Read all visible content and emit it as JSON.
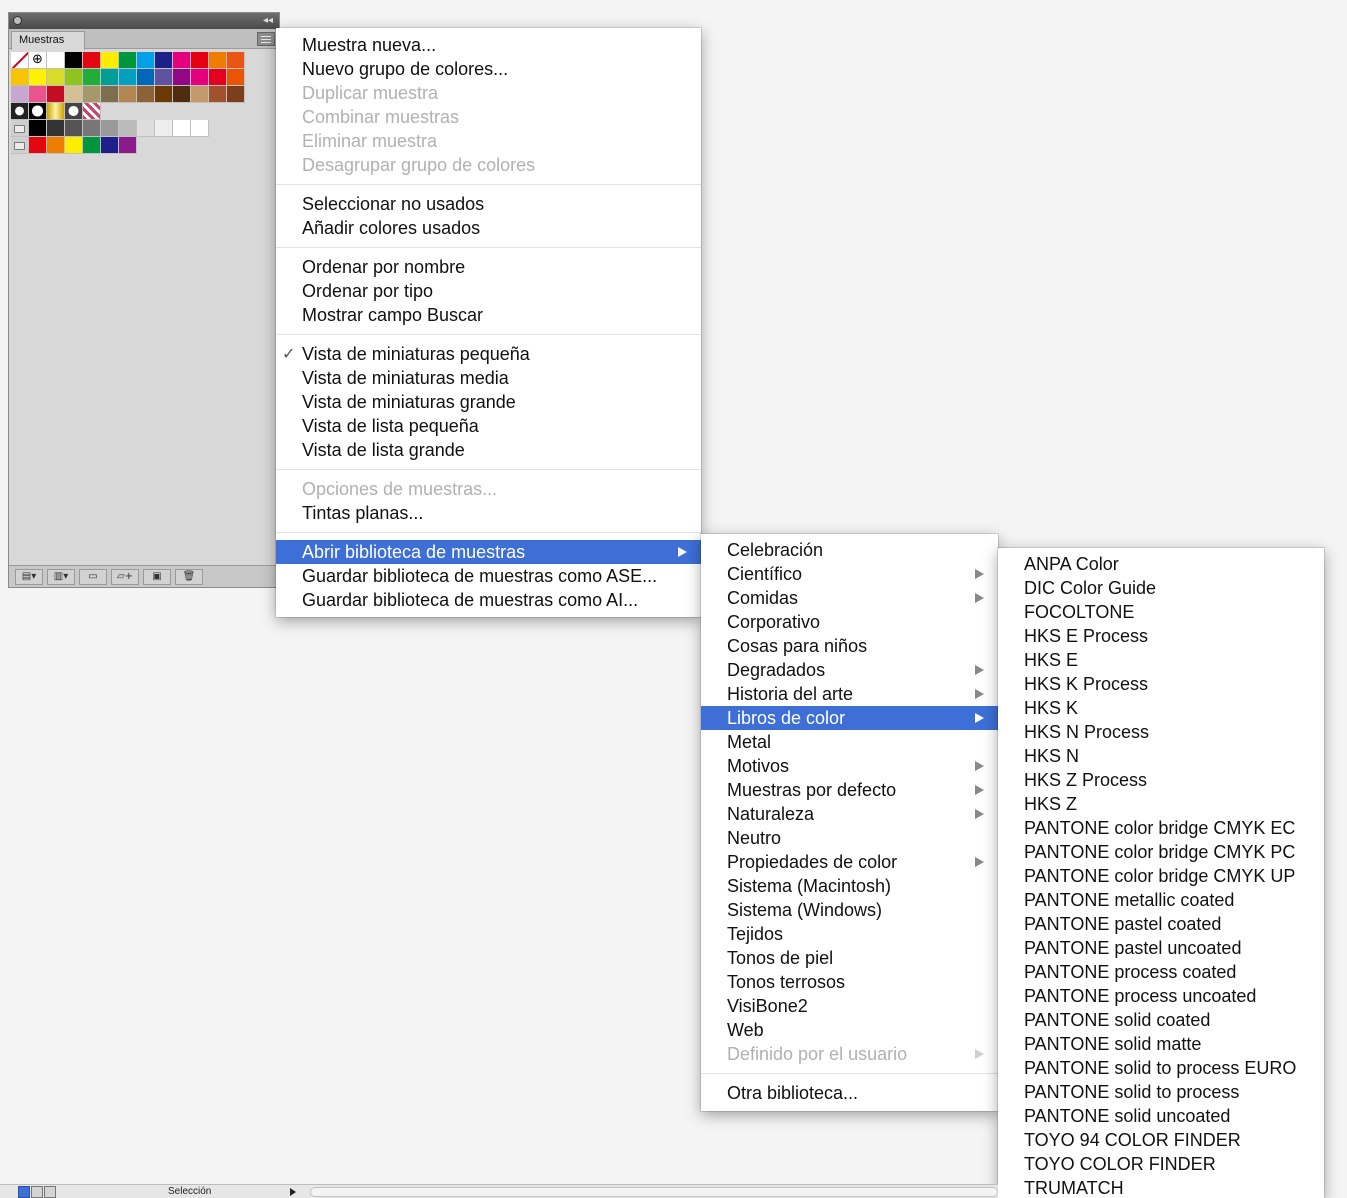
{
  "panel": {
    "tab_label": "Muestras",
    "swatch_rows": [
      [
        "none",
        "registration",
        "#ffffff",
        "#000000",
        "#e30613",
        "#ffed00",
        "#009640",
        "#00a0e9",
        "#1d2088",
        "#e4007f",
        "#e50012",
        "#ef7d00",
        "#e95513"
      ],
      [
        "#f8c300",
        "#fff100",
        "#d7dd27",
        "#8fc31f",
        "#22ac38",
        "#009e96",
        "#00a0c1",
        "#0068b7",
        "#5f52a0",
        "#920783",
        "#e5007f",
        "#e6001f",
        "#ea5504"
      ],
      [
        "#c7a7d0",
        "#e9548c",
        "#c30d23",
        "#d3c195",
        "#a5986d",
        "#7d6f4e",
        "#b28650",
        "#8d6238",
        "#6a3906",
        "#4e2c0f",
        "#c49a6c",
        "#a0522d",
        "#7b3f1d"
      ],
      [
        "pattern",
        "pattern",
        "pattern",
        "pattern",
        "pattern"
      ],
      [
        "folder",
        "#000000",
        "#333333",
        "#555555",
        "#777777",
        "#999999",
        "#bbbbbb",
        "#dddddd",
        "#eeeeee",
        "#ffffff",
        "#ffffff"
      ],
      [
        "folder",
        "#e30613",
        "#ef7d00",
        "#ffed00",
        "#009640",
        "#1d2088",
        "#8b1a8b"
      ]
    ]
  },
  "main_menu": {
    "groups": [
      [
        {
          "label": "Muestra nueva...",
          "disabled": false
        },
        {
          "label": "Nuevo grupo de colores...",
          "disabled": false
        },
        {
          "label": "Duplicar muestra",
          "disabled": true
        },
        {
          "label": "Combinar muestras",
          "disabled": true
        },
        {
          "label": "Eliminar muestra",
          "disabled": true
        },
        {
          "label": "Desagrupar grupo de colores",
          "disabled": true
        }
      ],
      [
        {
          "label": "Seleccionar no usados",
          "disabled": false
        },
        {
          "label": "Añadir colores usados",
          "disabled": false
        }
      ],
      [
        {
          "label": "Ordenar por nombre",
          "disabled": false
        },
        {
          "label": "Ordenar por tipo",
          "disabled": false
        },
        {
          "label": "Mostrar campo Buscar",
          "disabled": false
        }
      ],
      [
        {
          "label": "Vista de miniaturas pequeña",
          "disabled": false,
          "checked": true
        },
        {
          "label": "Vista de miniaturas media",
          "disabled": false
        },
        {
          "label": "Vista de miniaturas grande",
          "disabled": false
        },
        {
          "label": "Vista de lista pequeña",
          "disabled": false
        },
        {
          "label": "Vista de lista grande",
          "disabled": false
        }
      ],
      [
        {
          "label": "Opciones de muestras...",
          "disabled": true
        },
        {
          "label": "Tintas planas...",
          "disabled": false
        }
      ],
      [
        {
          "label": "Abrir biblioteca de muestras",
          "disabled": false,
          "highlight": true,
          "submenu": true
        },
        {
          "label": "Guardar biblioteca de muestras como ASE...",
          "disabled": false
        },
        {
          "label": "Guardar biblioteca de muestras como AI...",
          "disabled": false
        }
      ]
    ]
  },
  "sub_menu": {
    "groups": [
      [
        {
          "label": "Celebración"
        },
        {
          "label": "Científico",
          "submenu": true
        },
        {
          "label": "Comidas",
          "submenu": true
        },
        {
          "label": "Corporativo"
        },
        {
          "label": "Cosas para niños"
        },
        {
          "label": "Degradados",
          "submenu": true
        },
        {
          "label": "Historia del arte",
          "submenu": true
        },
        {
          "label": "Libros de color",
          "submenu": true,
          "highlight": true
        },
        {
          "label": "Metal"
        },
        {
          "label": "Motivos",
          "submenu": true
        },
        {
          "label": "Muestras por defecto",
          "submenu": true
        },
        {
          "label": "Naturaleza",
          "submenu": true
        },
        {
          "label": "Neutro"
        },
        {
          "label": "Propiedades de color",
          "submenu": true
        },
        {
          "label": "Sistema (Macintosh)"
        },
        {
          "label": "Sistema (Windows)"
        },
        {
          "label": "Tejidos"
        },
        {
          "label": "Tonos de piel"
        },
        {
          "label": "Tonos terrosos"
        },
        {
          "label": "VisiBone2"
        },
        {
          "label": "Web"
        },
        {
          "label": "Definido por el usuario",
          "submenu": true,
          "disabled": true
        }
      ],
      [
        {
          "label": "Otra biblioteca..."
        }
      ]
    ]
  },
  "sub_sub_menu": {
    "items": [
      "ANPA Color",
      "DIC Color Guide",
      "FOCOLTONE",
      "HKS E Process",
      "HKS E",
      "HKS K Process",
      "HKS K",
      "HKS N Process",
      "HKS N",
      "HKS Z Process",
      "HKS Z",
      "PANTONE color bridge CMYK EC",
      "PANTONE color bridge CMYK PC",
      "PANTONE color bridge CMYK UP",
      "PANTONE metallic coated",
      "PANTONE pastel coated",
      "PANTONE pastel uncoated",
      "PANTONE process coated",
      "PANTONE process uncoated",
      "PANTONE solid coated",
      "PANTONE solid matte",
      "PANTONE solid to process EURO",
      "PANTONE solid to process",
      "PANTONE solid uncoated",
      "TOYO 94 COLOR FINDER",
      "TOYO COLOR FINDER",
      "TRUMATCH"
    ]
  },
  "statusbar": {
    "label": "Selección"
  },
  "colors": {
    "highlight": "#3d6fd6",
    "disabled_text": "#b1b1b1"
  }
}
